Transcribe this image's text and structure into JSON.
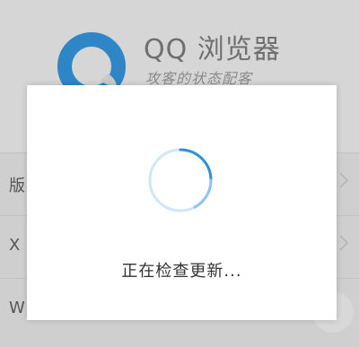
{
  "app": {
    "status_text": "",
    "name": "QQ 浏览器",
    "slogan": "攻客的状态配客"
  },
  "list": {
    "items": [
      {
        "lead": "版"
      },
      {
        "lead": "X"
      },
      {
        "lead": "W"
      }
    ]
  },
  "dialog": {
    "message": "正在检查更新..."
  },
  "colors": {
    "spinner_accent": "#2d8fe0",
    "spinner_track": "#cfe6fb"
  },
  "icons": {
    "logo": "qq-browser-logo-icon",
    "spinner": "loading-spinner-icon",
    "chevron": "chevron-right-icon"
  }
}
